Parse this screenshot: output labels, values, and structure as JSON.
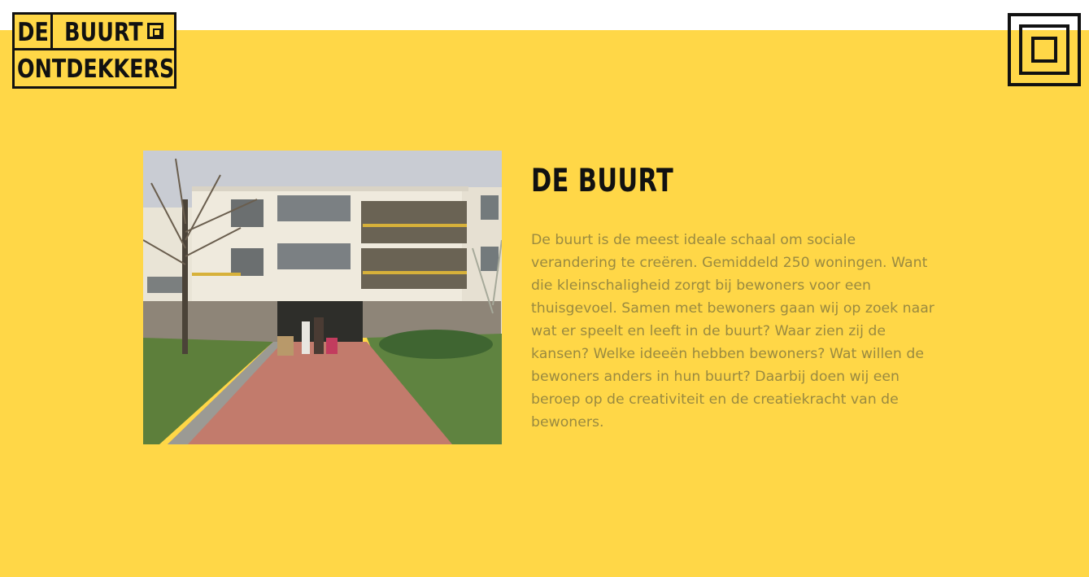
{
  "logo": {
    "word1": "DE",
    "word2": "BUURT",
    "word3": "ONTDEKKERS"
  },
  "section": {
    "title": "DE BUURT",
    "text": "De buurt is de meest ideale schaal om sociale verandering te creëren. Gemiddeld 250 woningen. Want die kleinschaligheid zorgt bij bewoners voor een thuisgevoel. Samen met bewoners gaan wij op zoek naar wat er speelt en leeft in de buurt? Waar zien zij de kansen? Welke ideeën hebben bewoners? Wat willen de bewoners anders in hun buurt? Daarbij doen wij een beroep op de creativiteit en de creatiekracht van de bewoners."
  },
  "colors": {
    "background": "#ffd747",
    "text_dark": "#111111",
    "body_text": "#9a8a40"
  },
  "icons": {
    "menu": "nested-squares-menu-icon",
    "logo_mark": "nested-squares-icon"
  }
}
